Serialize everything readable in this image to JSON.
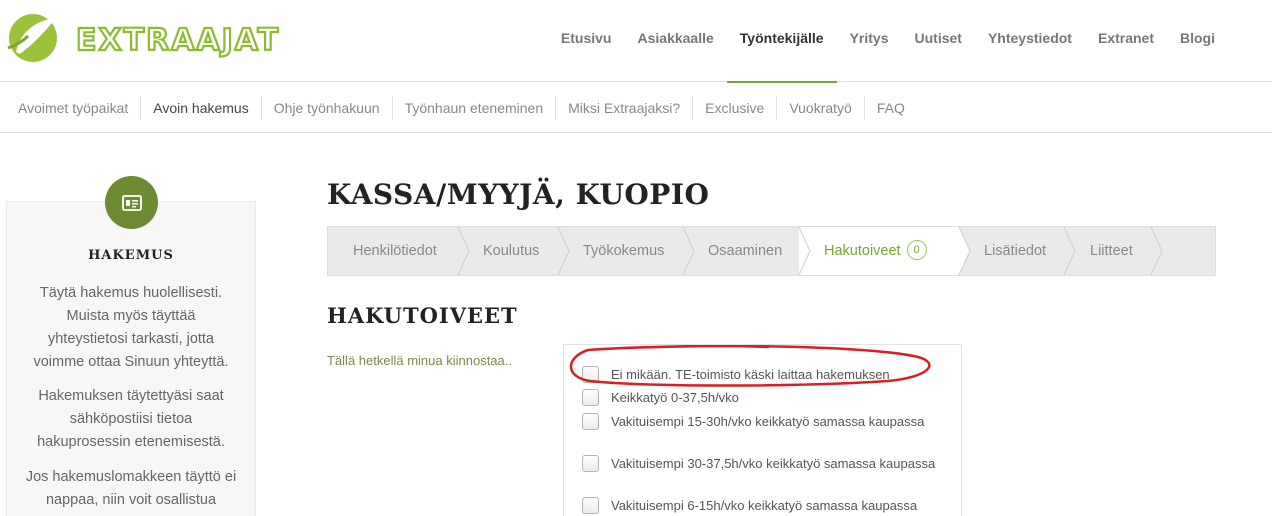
{
  "brand": {
    "name": "EXTRAAJAT",
    "accent": "#7aa436",
    "dark_accent": "#6e8b34",
    "annotation_color": "#d81f26"
  },
  "main_nav": [
    {
      "label": "Etusivu",
      "active": false
    },
    {
      "label": "Asiakkaalle",
      "active": false
    },
    {
      "label": "Työntekijälle",
      "active": true
    },
    {
      "label": "Yritys",
      "active": false
    },
    {
      "label": "Uutiset",
      "active": false
    },
    {
      "label": "Yhteystiedot",
      "active": false
    },
    {
      "label": "Extranet",
      "active": false
    },
    {
      "label": "Blogi",
      "active": false
    }
  ],
  "sub_nav": [
    {
      "label": "Avoimet työpaikat",
      "active": false
    },
    {
      "label": "Avoin hakemus",
      "active": true
    },
    {
      "label": "Ohje työnhakuun",
      "active": false
    },
    {
      "label": "Työnhaun eteneminen",
      "active": false
    },
    {
      "label": "Miksi Extraajaksi?",
      "active": false
    },
    {
      "label": "Exclusive",
      "active": false
    },
    {
      "label": "Vuokratyö",
      "active": false
    },
    {
      "label": "FAQ",
      "active": false
    }
  ],
  "sidebar": {
    "icon": "id-card-icon",
    "title": "HAKEMUS",
    "paragraphs": [
      "Täytä hakemus huolellisesti. Muista myös täyttää yhteystietosi tarkasti, jotta voimme ottaa Sinuun yhteyttä.",
      "Hakemuksen täytettyäsi saat sähköpostiisi tietoa hakuprosessin etenemisestä.",
      "Jos hakemuslomakkeen täyttö ei nappaa, niin voit osallistua"
    ]
  },
  "page_title": "KASSA/MYYJÄ, KUOPIO",
  "steps": [
    {
      "label": "Henkilötiedot",
      "active": false
    },
    {
      "label": "Koulutus",
      "active": false
    },
    {
      "label": "Työkokemus",
      "active": false
    },
    {
      "label": "Osaaminen",
      "active": false
    },
    {
      "label": "Hakutoiveet",
      "active": true,
      "badge": "0"
    },
    {
      "label": "Lisätiedot",
      "active": false
    },
    {
      "label": "Liitteet",
      "active": false
    }
  ],
  "section_title": "HAKUTOIVEET",
  "form_label": "Tällä hetkellä minua kiinnostaa..",
  "options": [
    {
      "label": "Ei mikään. TE-toimisto käski laittaa hakemuksen",
      "checked": false
    },
    {
      "label": "Keikkatyö 0-37,5h/vko",
      "checked": false
    },
    {
      "label": "Vakituisempi 15-30h/vko keikkatyö samassa kaupassa",
      "checked": false
    },
    {
      "label": "Vakituisempi 30-37,5h/vko keikkatyö samassa kaupassa",
      "checked": false
    },
    {
      "label": "Vakituisempi 6-15h/vko keikkatyö samassa kaupassa",
      "checked": false
    }
  ]
}
